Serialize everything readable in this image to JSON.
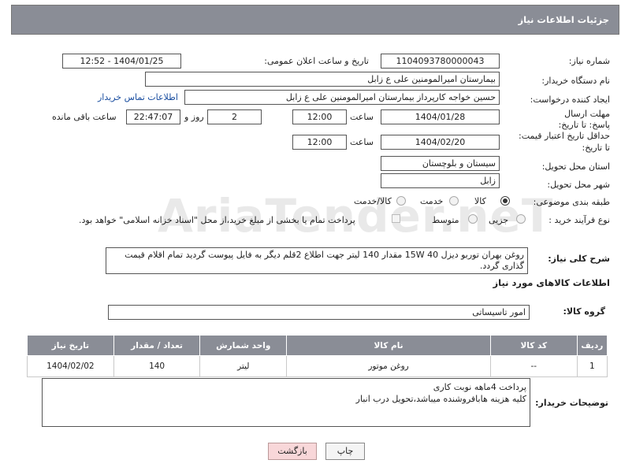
{
  "header": {
    "title": "جزئیات اطلاعات نیاز"
  },
  "watermark": "AriaTender.neT",
  "fields": {
    "need_number_label": "شماره نیاز:",
    "need_number": "1104093780000043",
    "announce_label": "تاریخ و ساعت اعلان عمومی:",
    "announce_value": "1404/01/25 - 12:52",
    "buyer_org_label": "نام دستگاه خریدار:",
    "buyer_org": "بیمارستان امیرالمومنین علی  ع  زابل",
    "requester_label": "ایجاد کننده درخواست:",
    "requester": "حسین خواجه کارپرداز بیمارستان امیرالمومنین علی  ع  زابل",
    "contact_link": "اطلاعات تماس خریدار",
    "deadline_label": "مهلت ارسال پاسخ: تا تاریخ:",
    "deadline_date": "1404/01/28",
    "time_label": "ساعت",
    "deadline_time": "12:00",
    "days_value": "2",
    "days_label": "روز و",
    "remaining_value": "22:47:07",
    "remaining_label": "ساعت باقی مانده",
    "min_validity_label_1": "حداقل تاریخ اعتبار قیمت:",
    "min_validity_label_2": "تا تاریخ:",
    "validity_date": "1404/02/20",
    "validity_time": "12:00",
    "province_label": "استان محل تحویل:",
    "province": "سیستان و بلوچستان",
    "city_label": "شهر محل تحویل:",
    "city": "زابل",
    "category_label": "طبقه بندی موضوعی:",
    "category_options": [
      "کالا",
      "خدمت",
      "کالا/خدمت"
    ],
    "category_selected": "کالا",
    "process_label": "نوع فرآیند خرید :",
    "process_options": [
      "جزیی",
      "متوسط"
    ],
    "payment_note": "پرداخت تمام یا بخشی از مبلغ خرید،از محل \"اسناد خزانه اسلامی\" خواهد بود."
  },
  "description": {
    "label": "شرح کلی نیاز:",
    "text": "روغن بهران توربو دیزل 40 15W  مقدار 140 لیتر جهت اطلاع 2قلم دیگر به فایل پیوست گردید تمام اقلام قیمت گذاری گردد."
  },
  "goods": {
    "title": "اطلاعات کالاهای مورد نیاز",
    "group_label": "گروه کالا:",
    "group_value": "امور تاسیساتی",
    "columns": [
      "ردیف",
      "کد کالا",
      "نام کالا",
      "واحد شمارش",
      "تعداد / مقدار",
      "تاریخ نیاز"
    ],
    "rows": [
      [
        "1",
        "--",
        "روغن موتور",
        "لیتر",
        "140",
        "1404/02/02"
      ]
    ]
  },
  "buyer_notes": {
    "label": "توضیحات خریدار:",
    "line1": "پرداخت 4ماهه نوبت کاری",
    "line2": "کلیه هزینه هابافروشنده میباشد،تحویل درب انبار"
  },
  "buttons": {
    "print": "چاپ",
    "back": "بازگشت"
  }
}
